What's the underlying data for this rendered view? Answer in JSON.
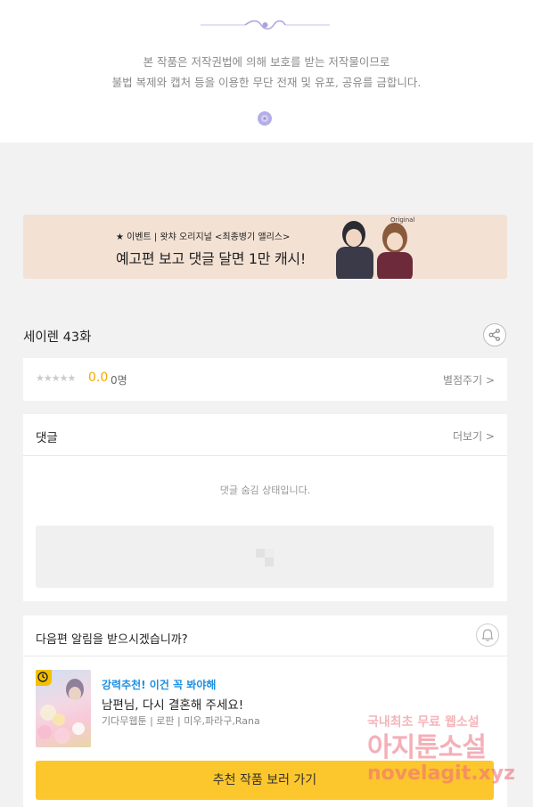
{
  "notice": {
    "line1": "본 작품은 저작권법에 의해 보호를 받는 저작물이므로",
    "line2": "불법 복제와 캡처 등을 이용한 무단 전재 및 유포, 공유를 금합니다."
  },
  "banner": {
    "subtitle": "★ 이벤트 | 왓챠 오리지널 <최종병기 앨리스>",
    "headline": "예고편 보고 댓글 달면 1만 캐시!",
    "logo_text": "Original"
  },
  "episode": {
    "title": "세이렌 43화"
  },
  "rating": {
    "stars": "★★★★★",
    "score": "0.0",
    "count": "0명",
    "rate_button": "별점주기 >"
  },
  "comments": {
    "title": "댓글",
    "more": "더보기 >",
    "hidden_message": "댓글 숨김 상태입니다."
  },
  "notify": {
    "question": "다음편 알림을 받으시겠습니까?",
    "recommend_tag": "강력추천! 이건 꼭 봐야해",
    "recommend_title": "남편님, 다시 결혼해 주세요!",
    "recommend_meta": "기다무웹툰 | 로판 | 미우,파라구,Rana",
    "cta": "추천 작품 보러 가기"
  },
  "watermark": {
    "line1": "국내최초 무료 웹소설",
    "line2": "아지툰소설",
    "line3": "novelagit.xyz"
  },
  "colors": {
    "accent_yellow": "#fcc62d",
    "score_orange": "#f5a700",
    "tag_blue": "#1f8fe0",
    "banner_bg": "#f3e1d4"
  }
}
